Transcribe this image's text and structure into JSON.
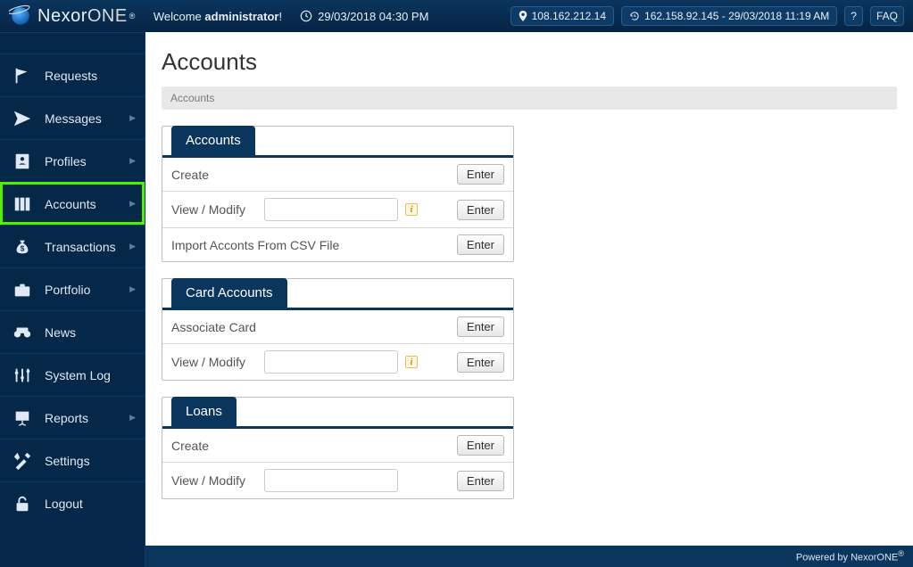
{
  "brand": {
    "name_a": "Nexor",
    "name_b": "ONE",
    "reg": "®"
  },
  "header": {
    "welcome_pre": "Welcome ",
    "welcome_user": "administrator",
    "welcome_post": "!",
    "datetime": "29/03/2018 04:30 PM",
    "ip_current": "108.162.212.14",
    "ip_prev": "162.158.92.145 - 29/03/2018 11:19 AM",
    "help": "?",
    "faq": "FAQ"
  },
  "nav": {
    "items": [
      {
        "label": "Requests",
        "sub": false
      },
      {
        "label": "Messages",
        "sub": true
      },
      {
        "label": "Profiles",
        "sub": true
      },
      {
        "label": "Accounts",
        "sub": true
      },
      {
        "label": "Transactions",
        "sub": true
      },
      {
        "label": "Portfolio",
        "sub": true
      },
      {
        "label": "News",
        "sub": false
      },
      {
        "label": "System Log",
        "sub": false
      },
      {
        "label": "Reports",
        "sub": true
      },
      {
        "label": "Settings",
        "sub": false
      },
      {
        "label": "Logout",
        "sub": false
      }
    ]
  },
  "page": {
    "title": "Accounts",
    "crumb": "Accounts"
  },
  "panels": {
    "accounts": {
      "title": "Accounts",
      "create": "Create",
      "view_modify": "View / Modify",
      "import": "Import Acconts From CSV File",
      "enter": "Enter"
    },
    "card": {
      "title": "Card Accounts",
      "associate": "Associate Card",
      "view_modify": "View / Modify",
      "enter": "Enter"
    },
    "loans": {
      "title": "Loans",
      "create": "Create",
      "view_modify": "View / Modify",
      "enter": "Enter"
    }
  },
  "footer": {
    "text": "Powered by NexorONE",
    "reg": "®"
  }
}
